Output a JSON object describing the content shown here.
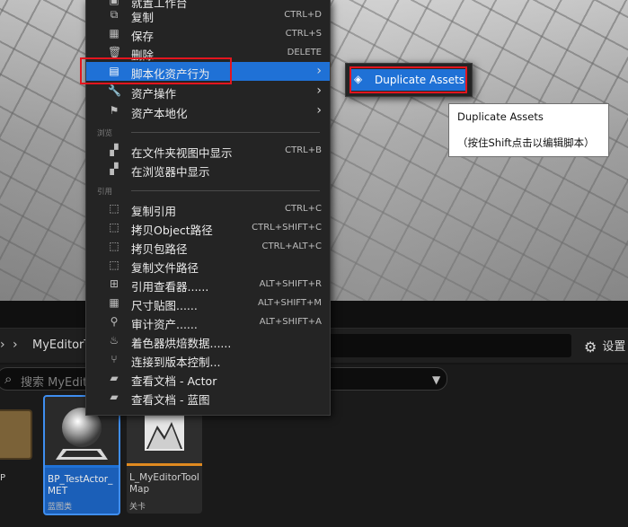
{
  "context_menu": {
    "top_label": "就置工作台",
    "items_top": [
      {
        "icon": "duplicate-icon",
        "label": "复制",
        "shortcut": "CTRL+D"
      },
      {
        "icon": "save-icon",
        "label": "保存",
        "shortcut": "CTRL+S"
      },
      {
        "icon": "trash-icon",
        "label": "删除",
        "shortcut": "DELETE"
      },
      {
        "icon": "script-icon",
        "label": "脚本化资产行为",
        "shortcut": ""
      },
      {
        "icon": "wrench-icon",
        "label": "资产操作",
        "shortcut": ""
      },
      {
        "icon": "flag-icon",
        "label": "资产本地化",
        "shortcut": ""
      }
    ],
    "section_browse": "浏览",
    "items_browse": [
      {
        "icon": "folder-search-icon",
        "label": "在文件夹视图中显示",
        "shortcut": "CTRL+B"
      },
      {
        "icon": "browser-search-icon",
        "label": "在浏览器中显示",
        "shortcut": ""
      }
    ],
    "section_refs": "引用",
    "items_refs": [
      {
        "icon": "copy-ref-icon",
        "label": "复制引用",
        "shortcut": "CTRL+C"
      },
      {
        "icon": "copy-path-icon",
        "label": "拷贝Object路径",
        "shortcut": "CTRL+SHIFT+C"
      },
      {
        "icon": "copy-package-icon",
        "label": "拷贝包路径",
        "shortcut": "CTRL+ALT+C"
      },
      {
        "icon": "copy-file-icon",
        "label": "复制文件路径",
        "shortcut": ""
      },
      {
        "icon": "reference-viewer-icon",
        "label": "引用查看器......",
        "shortcut": "ALT+SHIFT+R"
      },
      {
        "icon": "size-map-icon",
        "label": "尺寸贴图......",
        "shortcut": "ALT+SHIFT+M"
      },
      {
        "icon": "audit-icon",
        "label": "审计资产......",
        "shortcut": "ALT+SHIFT+A"
      },
      {
        "icon": "shader-icon",
        "label": "着色器烘焙数据......",
        "shortcut": ""
      },
      {
        "icon": "source-control-icon",
        "label": "连接到版本控制...",
        "shortcut": ""
      },
      {
        "icon": "doc-icon",
        "label": "查看文档 - Actor",
        "shortcut": ""
      },
      {
        "icon": "doc-icon",
        "label": "查看文档 - 蓝图",
        "shortcut": ""
      }
    ]
  },
  "submenu": {
    "label": "Duplicate Assets"
  },
  "tooltip": {
    "line1": "Duplicate Assets",
    "line2": "（按住Shift点击以编辑脚本）"
  },
  "content_browser": {
    "breadcrumb_item": "MyEditorT",
    "settings_label": "设置",
    "search_placeholder": "搜索 MyEdito",
    "partial_tile_label": "P",
    "tiles": [
      {
        "name": "BP_TestActor_MET",
        "name_line1": "BP_TestActor_",
        "name_line2": "MET",
        "type": "蓝图类",
        "accent": "#1f71d6"
      },
      {
        "name": "L_MyEditorToolMap",
        "name_line1": "L_MyEditorTool",
        "name_line2": "Map",
        "type": "关卡",
        "accent": "#e08a20"
      }
    ]
  },
  "colors": {
    "highlight": "#1f71d6",
    "annotation_red": "#e3151e"
  }
}
